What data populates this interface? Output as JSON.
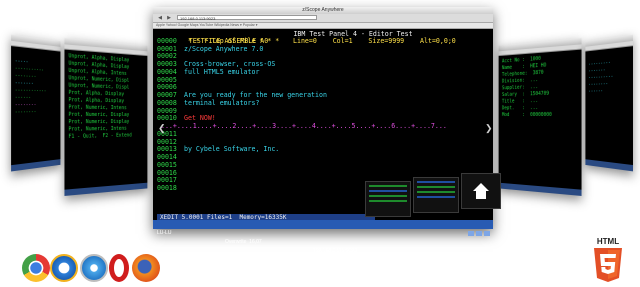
{
  "browser": {
    "window_title": "z/Scope Anywhere",
    "url": "192.168.0.113:9023",
    "bookmarks": "Apple  Yahoo!  Google Maps  YouTube  Wikipedia  News ▾  Popular ▾"
  },
  "terminal": {
    "header_left": "TESTFILE ASSEMBLE A0",
    "header_title": "IBM Test Panel 4 - Editor Test",
    "header_right": "Line=0    Col=1    Size=9999    Alt=0,0;0",
    "lines": [
      {
        "num": "00000",
        "text": " * * * Top of File * * *",
        "style": "top"
      },
      {
        "num": "00001",
        "text": "z/Scope Anywhere 7.0",
        "style": "cyan"
      },
      {
        "num": "00002",
        "text": "",
        "style": "cyan"
      },
      {
        "num": "00003",
        "text": "Cross-browser, cross-OS",
        "style": "cyan"
      },
      {
        "num": "00004",
        "text": "full HTML5 emulator",
        "style": "cyan"
      },
      {
        "num": "00005",
        "text": "",
        "style": "cyan"
      },
      {
        "num": "00006",
        "text": "",
        "style": "cyan"
      },
      {
        "num": "00007",
        "text": "Are you ready for the new generation",
        "style": "cyan"
      },
      {
        "num": "00008",
        "text": "terminal emulators?",
        "style": "cyan"
      },
      {
        "num": "00009",
        "text": "",
        "style": "cyan"
      },
      {
        "num": "00010",
        "text": "Get NOW!",
        "style": "red"
      },
      {
        "num": "",
        "text": " ...+....1....+....2....+....3....+....4....+....5....+....6....+....7...",
        "style": "ruler"
      },
      {
        "num": "00011",
        "text": "",
        "style": "cyan"
      },
      {
        "num": "00012",
        "text": "",
        "style": "cyan"
      },
      {
        "num": "00013",
        "text": "by Cybele Software, Inc.",
        "style": "cyan"
      },
      {
        "num": "00014",
        "text": "",
        "style": "cyan"
      },
      {
        "num": "00015",
        "text": "",
        "style": "cyan"
      },
      {
        "num": "00016",
        "text": "",
        "style": "cyan"
      },
      {
        "num": "00017",
        "text": "",
        "style": "cyan"
      },
      {
        "num": "00018",
        "text": "",
        "style": "cyan"
      }
    ],
    "command_line": "XEDIT 5.0001 Files=1  Memory=16335K",
    "status": {
      "lu": "LU-LU",
      "mode": "Overwrite  16,07",
      "ip": "192.168.0.115:9023"
    }
  },
  "side_screens": {
    "left_text": [
      "Unprot, Alpha, Display",
      "Unprot, Alpha, Display",
      "Unprot, Alpha, Intens",
      "",
      "Unprot, Numeric, Displ",
      "Unprot, Numeric, Displ",
      "",
      "Prot, Alpha, Display",
      "Prot, Alpha, Display",
      "Prot, Numeric, Intens",
      "",
      "Prot, Numeric, Display",
      "Prot, Numeric, Display",
      "Prot, Numeric, Intens",
      "",
      "F1 - Quit,  F2 - Extend"
    ],
    "right_text": [
      "Acct No :  1000",
      "Name    :  HEI HO",
      "Telephone:  3870",
      "Division:  ...",
      "Supplier:  ...",
      "Salary  :  1504709",
      "Title   :  ...",
      "Dept.   :  ...",
      "Mod     :  00000000"
    ]
  },
  "icons": [
    "chrome-icon",
    "ie-icon",
    "safari-icon",
    "opera-icon",
    "firefox-icon"
  ],
  "html5_label": "HTML"
}
